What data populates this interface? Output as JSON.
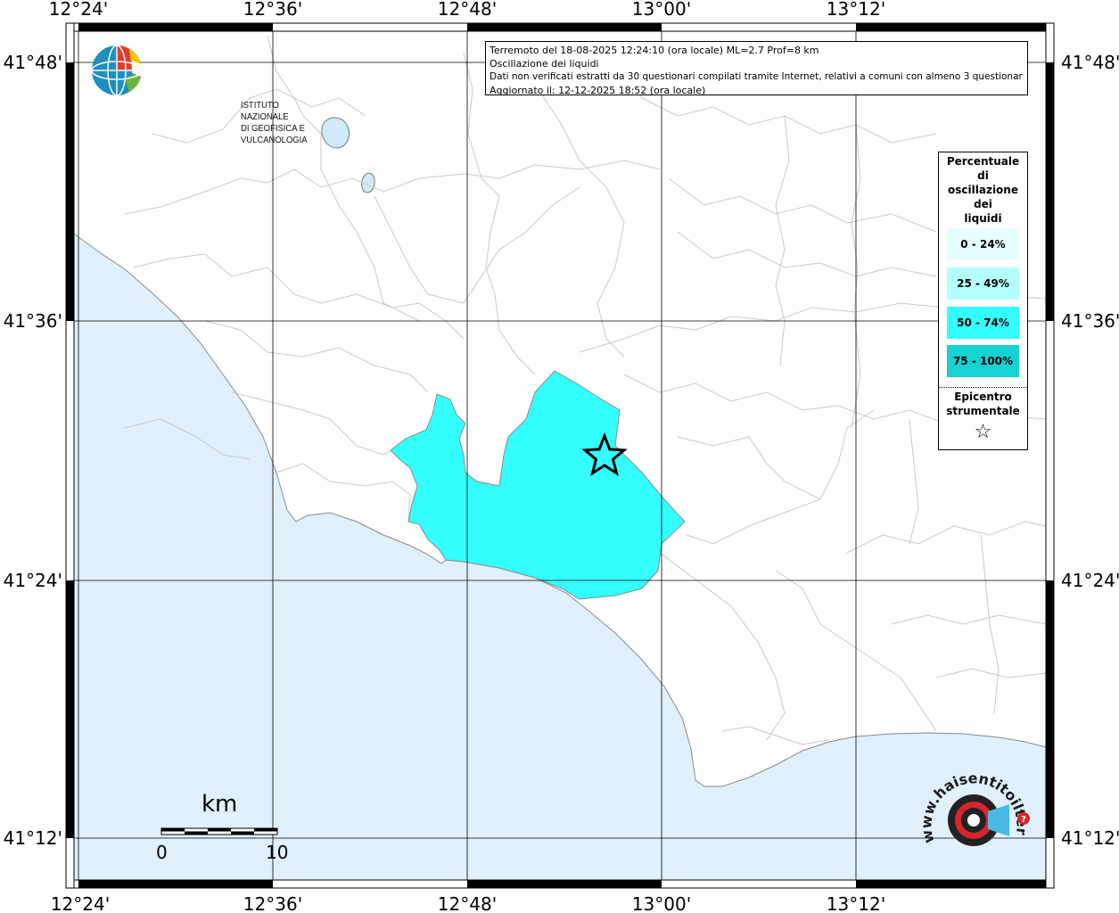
{
  "map": {
    "lon_labels": [
      "12°24'",
      "12°36'",
      "12°48'",
      "13°00'",
      "13°12'"
    ],
    "lat_labels": [
      "41°48'",
      "41°36'",
      "41°24'",
      "41°12'"
    ],
    "colors": {
      "sea": "#e0f0fc",
      "land": "#ffffff",
      "border": "#c8c8c8",
      "affected_area": "#33ffff",
      "lake": "#d2ebfa"
    }
  },
  "info": {
    "line1": "Terremoto del 18-08-2025 12:24:10 (ora locale) ML=2.7 Prof=8 km",
    "line2": "Oscillazione dei liquidi",
    "line3": "Dati non verificati estratti da 30 questionari compilati tramite Internet, relativi a comuni con almeno 3 questionari.",
    "line4": "Aggiornato il: 12-12-2025 18:52 (ora locale)"
  },
  "legend": {
    "title_lines": [
      "Percentuale",
      "di",
      "oscillazione",
      "dei",
      "liquidi"
    ],
    "items": [
      {
        "label": "0 - 24%",
        "color": "#e6fffe"
      },
      {
        "label": "25 - 49%",
        "color": "#b3fffc"
      },
      {
        "label": "50 - 74%",
        "color": "#33ffff"
      },
      {
        "label": "75 - 100%",
        "color": "#16d2d2"
      }
    ],
    "epicenter_lines": [
      "Epicentro",
      "strumentale"
    ],
    "epicenter_symbol": "☆"
  },
  "logo": {
    "line1": "ISTITUTO NAZIONALE",
    "line2": "DI GEOFISICA E VULCANOLOGIA"
  },
  "scalebar": {
    "unit": "km",
    "start": "0",
    "end": "10"
  },
  "hst_logo": {
    "text": "www.haisentitoilterremoto.it"
  }
}
